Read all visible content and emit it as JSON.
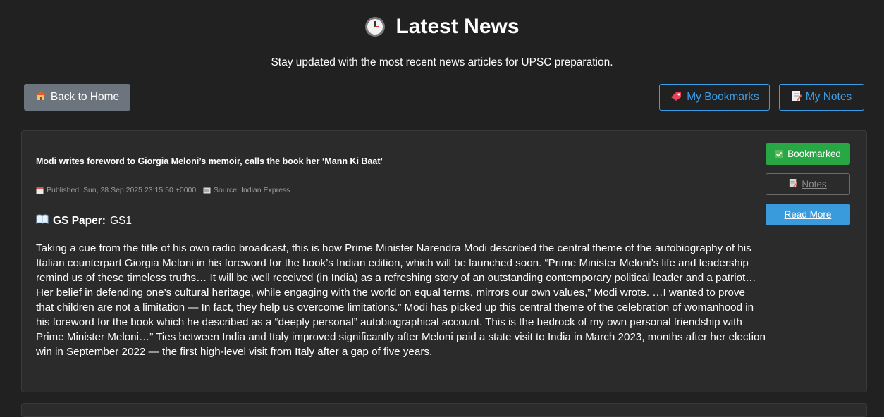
{
  "header": {
    "title": "Latest News",
    "subtitle": "Stay updated with the most recent news articles for UPSC preparation."
  },
  "nav": {
    "back_label": "Back to Home",
    "bookmarks_label": "My Bookmarks",
    "notes_label": "My Notes"
  },
  "article": {
    "title": "Modi writes foreword to Giorgia Meloni’s memoir, calls the book her ‘Mann Ki Baat’",
    "published": "Published: Sun, 28 Sep 2025 23:15:50 +0000 |",
    "source": "Source: Indian Express",
    "gs_label": "GS Paper:",
    "gs_value": "GS1",
    "summary": "Taking a cue from the title of his own radio broadcast, this is how Prime Minister Narendra Modi described the central theme of the autobiography of his Italian counterpart Giorgia Meloni in his foreword for the book’s Indian edition, which will be launched soon. “Prime Minister Meloni’s life and leadership remind us of these timeless truths… It will be well received (in India) as a refreshing story of an outstanding contemporary political leader and a patriot… Her belief in defending one’s cultural heritage, while engaging with the world on equal terms, mirrors our own values,” Modi wrote. …I wanted to prove that children are not a limitation — In fact, they help us overcome limitations.” Modi has picked up this central theme of the celebration of womanhood in his foreword for the book which he described as a “deeply personal” autobiographical account. This is the bedrock of my own personal friendship with Prime Minister Meloni…” Ties between India and Italy improved significantly after Meloni paid a state visit to India in March 2023, months after her election win in September 2022 — the first high-level visit from Italy after a gap of five years.",
    "bookmarked_label": "Bookmarked",
    "notes_label": "Notes",
    "read_more_label": "Read More"
  },
  "colors": {
    "background": "#212121",
    "card": "#2b2b2b",
    "accent_blue": "#3b9ee8",
    "bookmarked_green": "#28a745",
    "back_gray": "#6c757d"
  },
  "icons": {
    "title": "clock-icon",
    "back": "house-icon",
    "bookmarks": "bookmark-tag-icon",
    "notes": "memo-icon",
    "published": "calendar-icon",
    "source": "newspaper-icon",
    "gs": "open-book-icon",
    "bookmarked": "check-mark-icon"
  }
}
